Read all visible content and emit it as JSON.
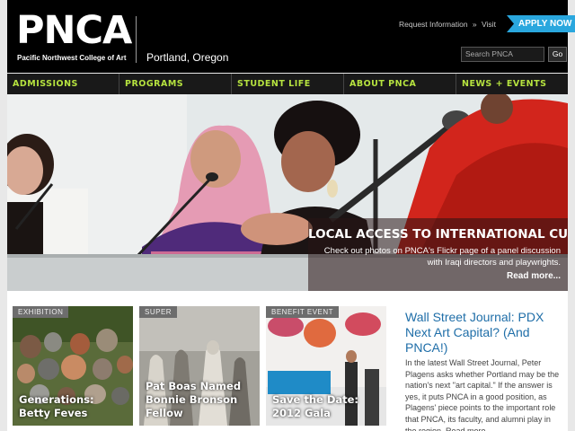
{
  "brand": {
    "logo_text": "PNCA",
    "logo_subtitle": "Pacific Northwest College of Art",
    "location": "Portland, Oregon"
  },
  "top_links": {
    "request_info": "Request Information",
    "separator": "»",
    "visit": "Visit",
    "apply": "APPLY NOW"
  },
  "search": {
    "placeholder": "Search PNCA",
    "go_label": "Go"
  },
  "nav": {
    "items": [
      {
        "label": "ADMISSIONS"
      },
      {
        "label": "PROGRAMS"
      },
      {
        "label": "STUDENT LIFE"
      },
      {
        "label": "ABOUT PNCA"
      },
      {
        "label": "NEWS + EVENTS"
      }
    ]
  },
  "hero": {
    "title": "LOCAL ACCESS TO INTERNATIONAL CULTURE",
    "body": "Check out photos on PNCA's Flickr page of a panel discussion with Iraqi directors and playwrights.",
    "more": "Read more..."
  },
  "tiles": [
    {
      "tag": "EXHIBITION",
      "title": "Generations: Betty Feves"
    },
    {
      "tag": "SUPER",
      "title": "Pat Boas Named Bonnie Bronson Fellow"
    },
    {
      "tag": "BENEFIT EVENT",
      "title": "Save the Date: 2012 Gala"
    }
  ],
  "article": {
    "title": "Wall Street Journal: PDX Next Art Capital? (And PNCA!)",
    "body": "In the latest Wall Street Journal, Peter Plagens asks whether Portland may be the nation's next \"art capital.\" If the answer is yes, it puts PNCA in a good position, as Plagens' piece points to the important role that PNCA, its faculty, and alumni play in the region. Read more..."
  },
  "colors": {
    "header_bg": "#000000",
    "nav_text": "#b6e33f",
    "apply_button": "#2aa7de",
    "article_title": "#1f6ea8"
  }
}
